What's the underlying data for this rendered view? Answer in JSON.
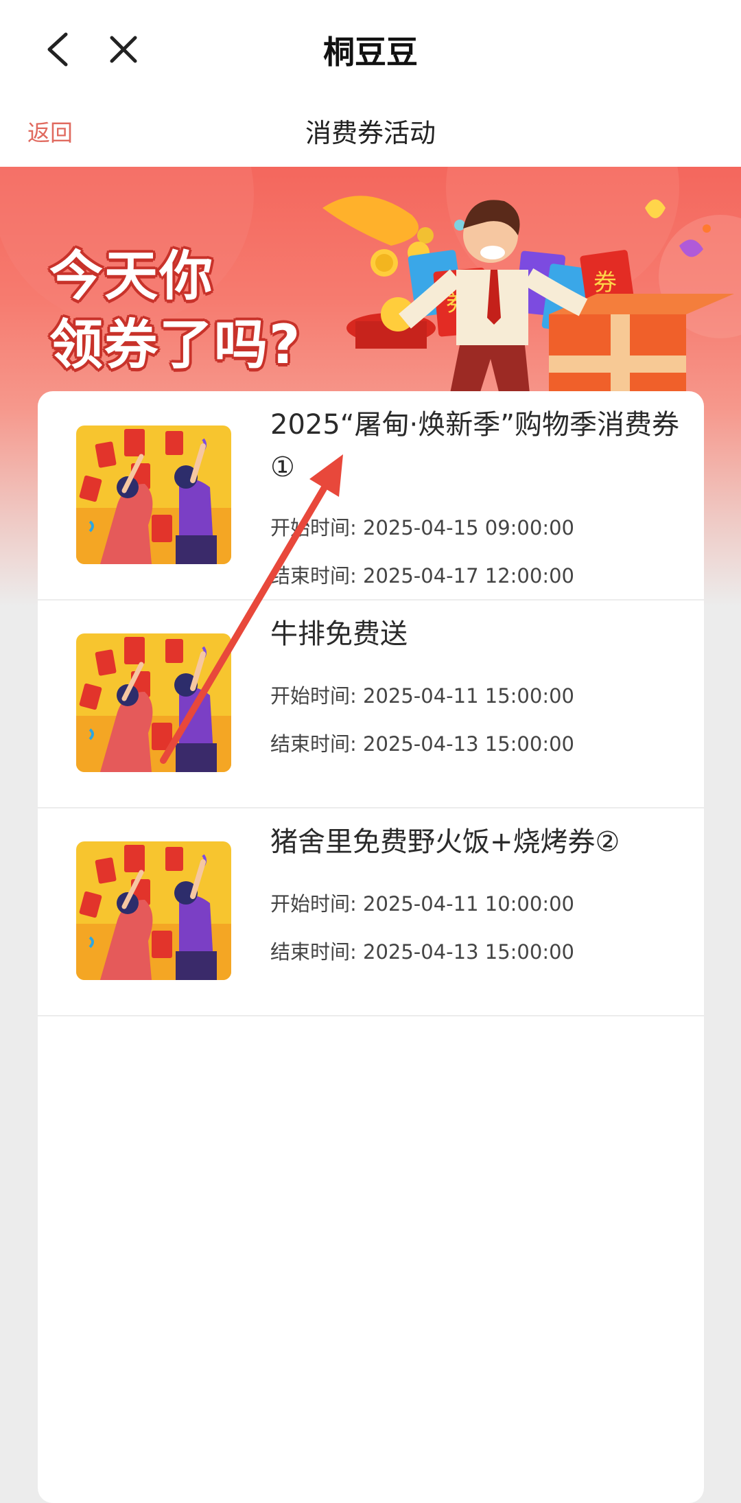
{
  "appbar": {
    "title": "桐豆豆"
  },
  "subbar": {
    "return_label": "返回",
    "page_title": "消费券活动"
  },
  "banner": {
    "slogan_line1": "今天你",
    "slogan_line2": "领券了吗?",
    "coupon_text": "券"
  },
  "coupons": [
    {
      "name": "2025“屠甸·焕新季”购物季消费券①",
      "start_label": "开始时间:",
      "start_time": "2025-04-15 09:00:00",
      "end_label": "结束时间:",
      "end_time": "2025-04-17 12:00:00"
    },
    {
      "name": "牛排免费送",
      "start_label": "开始时间:",
      "start_time": "2025-04-11 15:00:00",
      "end_label": "结束时间:",
      "end_time": "2025-04-13 15:00:00"
    },
    {
      "name": "猪舍里免费野火饭+烧烤券②",
      "start_label": "开始时间:",
      "start_time": "2025-04-11 10:00:00",
      "end_label": "结束时间:",
      "end_time": "2025-04-13 15:00:00"
    }
  ],
  "colors": {
    "accent": "#e06a5f",
    "banner_red": "#f4675d",
    "arrow": "#e8483b"
  }
}
